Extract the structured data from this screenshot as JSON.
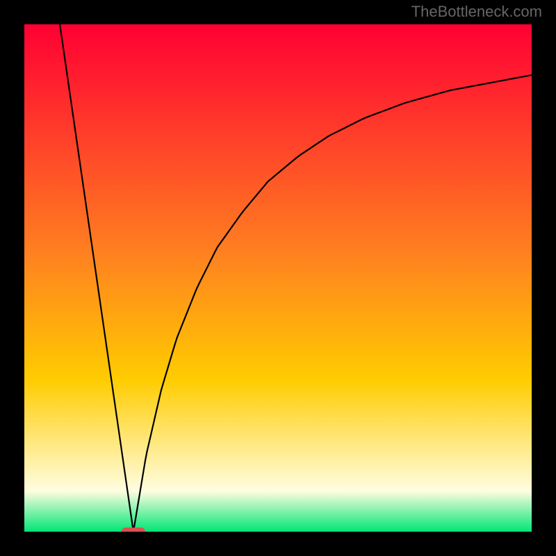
{
  "watermark": "TheBottleneck.com",
  "chart_data": {
    "type": "line",
    "title": "",
    "xlabel": "",
    "ylabel": "",
    "xlim": [
      0,
      100
    ],
    "ylim": [
      0,
      100
    ],
    "grid": false,
    "legend": false,
    "minimum_marker": {
      "x": 21.5,
      "y": 0,
      "color": "#d9534f"
    },
    "background_gradient": {
      "top": "#ff0033",
      "mid": "#ffcc00",
      "bottom": "#00e676",
      "near_bottom": "#fffde0"
    },
    "series": [
      {
        "name": "left-line",
        "x": [
          7,
          21.5
        ],
        "y": [
          100,
          0
        ]
      },
      {
        "name": "right-curve",
        "x": [
          21.5,
          24,
          27,
          30,
          34,
          38,
          43,
          48,
          54,
          60,
          67,
          75,
          84,
          92,
          100
        ],
        "y": [
          0,
          15,
          28,
          38,
          48,
          56,
          63,
          69,
          74,
          78,
          81.5,
          84.5,
          87,
          88.5,
          90
        ]
      }
    ]
  }
}
